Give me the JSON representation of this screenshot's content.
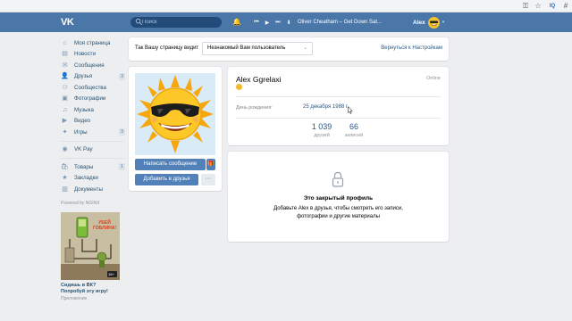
{
  "header": {
    "logo": "VK",
    "search_placeholder": "Поиск",
    "track": "Oliver Cheatham – Get Down Sat...",
    "user_name": "Alex"
  },
  "nav": {
    "items": [
      {
        "label": "Моя страница",
        "icon": "home-icon",
        "glyph": "⌂",
        "count": ""
      },
      {
        "label": "Новости",
        "icon": "news-icon",
        "glyph": "▤",
        "count": ""
      },
      {
        "label": "Сообщения",
        "icon": "messages-icon",
        "glyph": "✉",
        "count": ""
      },
      {
        "label": "Друзья",
        "icon": "friends-icon",
        "glyph": "👤",
        "count": "3"
      },
      {
        "label": "Сообщества",
        "icon": "groups-icon",
        "glyph": "⚇",
        "count": ""
      },
      {
        "label": "Фотографии",
        "icon": "photos-icon",
        "glyph": "▣",
        "count": ""
      },
      {
        "label": "Музыка",
        "icon": "music-icon",
        "glyph": "♫",
        "count": ""
      },
      {
        "label": "Видео",
        "icon": "video-icon",
        "glyph": "▶",
        "count": ""
      },
      {
        "label": "Игры",
        "icon": "games-icon",
        "glyph": "✦",
        "count": "3"
      }
    ],
    "pay": {
      "label": "VK Pay",
      "icon": "vkpay-icon",
      "glyph": "◉"
    },
    "extra": [
      {
        "label": "Товары",
        "icon": "goods-icon",
        "glyph": "🛍",
        "count": "1"
      },
      {
        "label": "Закладки",
        "icon": "bookmarks-icon",
        "glyph": "★",
        "count": ""
      },
      {
        "label": "Документы",
        "icon": "documents-icon",
        "glyph": "▥",
        "count": ""
      }
    ],
    "powered": "Powered by NGINX",
    "ad_banner_text": "УБЕЙ ГОБЛИНА!",
    "ad_badge": "16+",
    "ad_title": "Сидишь в ВК? Попробуй эту игру!",
    "ad_sub": "Приложение"
  },
  "topstrip": {
    "label": "Так Вашу страницу видит",
    "select_value": "Незнакомый Вам пользователь",
    "back_link": "Вернуться к Настройкам"
  },
  "profile": {
    "name": "Alex Ggrelaxi",
    "online": "Online",
    "birthday_label": "День рождения:",
    "birthday_value": "25 декабря 1988 г.",
    "friends_count": "1 039",
    "friends_label": "друзей",
    "posts_count": "66",
    "posts_label": "записей",
    "send_message": "Написать сообщение",
    "add_friend": "Добавить в друзья",
    "more": "···"
  },
  "closed": {
    "title": "Это закрытый профиль",
    "text": "Добавьте Alex в друзья, чтобы смотреть его записи, фотографии и другие материалы"
  },
  "colors": {
    "header": "#4a76a8",
    "accent": "#5181b8",
    "link": "#2a5885",
    "background": "#edeef0"
  }
}
